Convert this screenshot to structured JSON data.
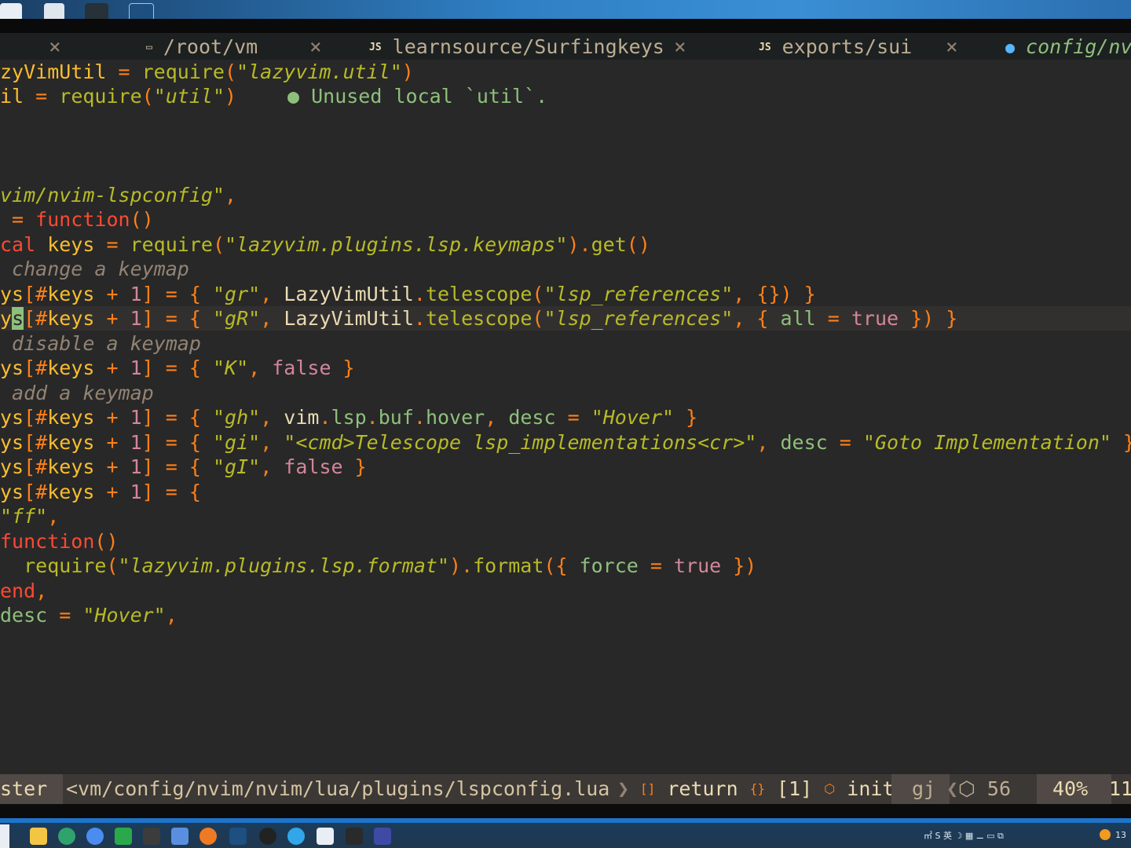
{
  "tabs": [
    {
      "label": "/root/vm",
      "icon": "window-icon",
      "active": false
    },
    {
      "label": "learnsource/Surfingkeys",
      "icon": "js-icon",
      "active": false
    },
    {
      "label": "exports/sui",
      "icon": "js-icon",
      "active": false
    },
    {
      "label": "config/nv",
      "icon": "react-icon",
      "active": true
    }
  ],
  "close_glyph": "×",
  "file_icon_js": "JS",
  "file_icon_win": "▭",
  "react_icon": "●",
  "code": {
    "l1": {
      "a": "zyVimUtil",
      "b": " = ",
      "c": "require",
      "d": "(",
      "e": "\"lazyvim.util\"",
      "f": ")"
    },
    "l2": {
      "a": "il",
      "b": " = ",
      "c": "require",
      "d": "(",
      "e": "\"util\"",
      "f": ")",
      "diag": "● Unused local `util`."
    },
    "l3": {
      "a": "vim/nvim-lspconfig\"",
      "b": ","
    },
    "l4": {
      "a": " = ",
      "b": "function",
      "c": "()"
    },
    "l5": {
      "a": "cal",
      "b": " keys",
      "c": " = ",
      "d": "require",
      "e": "(",
      "f": "\"lazyvim.plugins.lsp.keymaps\"",
      "g": ").",
      "h": "get",
      "i": "()"
    },
    "l6": {
      "a": " change a keymap"
    },
    "l7": {
      "a": "ys",
      "b": "[#",
      "c": "keys",
      "d": " + ",
      "e": "1",
      "f": "] = { ",
      "g": "\"gr\"",
      "h": ", ",
      "i": "LazyVimUtil",
      "j": ".",
      "k": "telescope",
      "l": "(",
      "m": "\"lsp_references\"",
      "n": ", {}) }"
    },
    "l8": {
      "cur_pre": "y",
      "cur": "s",
      "b": "[#",
      "c": "keys",
      "d": " + ",
      "e": "1",
      "f": "] = { ",
      "g": "\"gR\"",
      "h": ", ",
      "i": "LazyVimUtil",
      "j": ".",
      "k": "telescope",
      "l": "(",
      "m": "\"lsp_references\"",
      "n": ", { ",
      "o": "all",
      "p": " = ",
      "q": "true",
      "r": " }) }"
    },
    "l9": {
      "a": " disable a keymap"
    },
    "l10": {
      "a": "ys",
      "b": "[#",
      "c": "keys",
      "d": " + ",
      "e": "1",
      "f": "] = { ",
      "g": "\"K\"",
      "h": ", ",
      "i": "false",
      "j": " }"
    },
    "l11": {
      "a": " add a keymap"
    },
    "l12": {
      "a": "ys",
      "b": "[#",
      "c": "keys",
      "d": " + ",
      "e": "1",
      "f": "] = { ",
      "g": "\"gh\"",
      "h": ", ",
      "i": "vim",
      "j": ".",
      "k": "lsp",
      "l": ".",
      "m": "buf",
      "n": ".",
      "o": "hover",
      "p": ", ",
      "q": "desc",
      "r": " = ",
      "s": "\"Hover\"",
      "t": " }"
    },
    "l13": {
      "a": "ys",
      "b": "[#",
      "c": "keys",
      "d": " + ",
      "e": "1",
      "f": "] = { ",
      "g": "\"gi\"",
      "h": ", ",
      "i": "\"<cmd>Telescope lsp_implementations<cr>\"",
      "j": ", ",
      "k": "desc",
      "l": " = ",
      "m": "\"Goto Implementation\"",
      "n": " }"
    },
    "l14": {
      "a": "ys",
      "b": "[#",
      "c": "keys",
      "d": " + ",
      "e": "1",
      "f": "] = { ",
      "g": "\"gI\"",
      "h": ", ",
      "i": "false",
      "j": " }"
    },
    "l15": {
      "a": "ys",
      "b": "[#",
      "c": "keys",
      "d": " + ",
      "e": "1",
      "f": "] = {"
    },
    "l16": {
      "a": "\"ff\"",
      "b": ","
    },
    "l17": {
      "a": "function",
      "b": "()"
    },
    "l18": {
      "a": "  ",
      "b": "require",
      "c": "(",
      "d": "\"lazyvim.plugins.lsp.format\"",
      "e": ").",
      "f": "format",
      "g": "({ ",
      "h": "force",
      "i": " = ",
      "j": "true",
      "k": " })"
    },
    "l19": {
      "a": "end",
      "b": ","
    },
    "l20": {
      "a": "desc",
      "b": " = ",
      "c": "\"Hover\"",
      "d": ","
    }
  },
  "status": {
    "mode": "ster",
    "path": "<vm/config/nvim/nvim/lua/plugins/lspconfig.lua",
    "ctx_icon1": "[]",
    "ctx1": "return",
    "ctx_icon2": "{}",
    "ctx2": "[1]",
    "ctx_icon3": "⬡",
    "ctx3": "init",
    "keys": "gj",
    "col_icon": "⬡",
    "col": "56",
    "percent": "40%",
    "line": "11"
  },
  "tray": {
    "text": "㎡ S 英 ☽ ▦ ⚊ ▭ ⧉",
    "clock": "13"
  },
  "colors": {
    "bg": "#282828",
    "string": "#b8bb26",
    "keyword": "#fb4934",
    "operator": "#fe8019",
    "comment": "#928374",
    "field": "#8ec07c",
    "boolean": "#d3869b"
  }
}
